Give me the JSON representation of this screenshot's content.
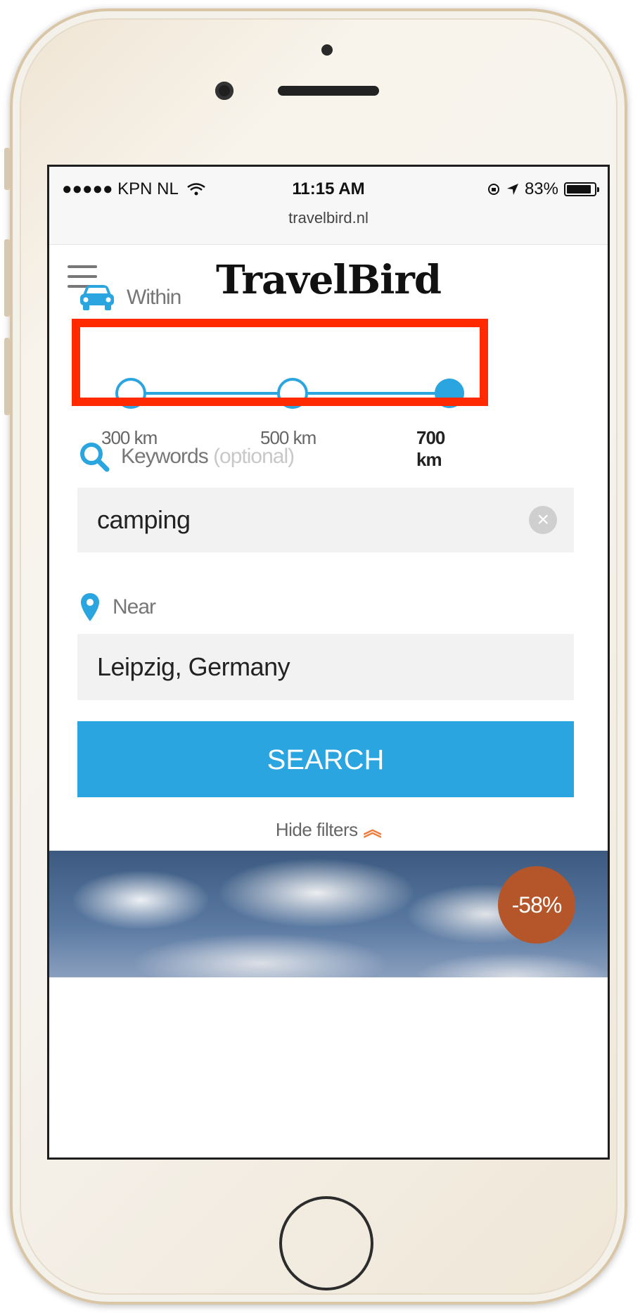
{
  "status_bar": {
    "carrier": "●●●●● KPN NL",
    "time": "11:15 AM",
    "battery_percent": "83%",
    "url": "travelbird.nl"
  },
  "header": {
    "logo_text": "TravelBird"
  },
  "within": {
    "label": "Within",
    "options": [
      "300 km",
      "500 km",
      "700 km"
    ],
    "selected": "700 km"
  },
  "keywords": {
    "label": "Keywords",
    "optional_label": "(optional)",
    "value": "camping"
  },
  "near": {
    "label": "Near",
    "value": "Leipzig, Germany"
  },
  "search_button": "SEARCH",
  "hide_filters": "Hide filters",
  "deal": {
    "discount": "-58%"
  },
  "colors": {
    "accent": "#2aa5df",
    "highlight": "#ff2a00",
    "discount_badge": "#b4552a",
    "chevron": "#f07a3a"
  }
}
